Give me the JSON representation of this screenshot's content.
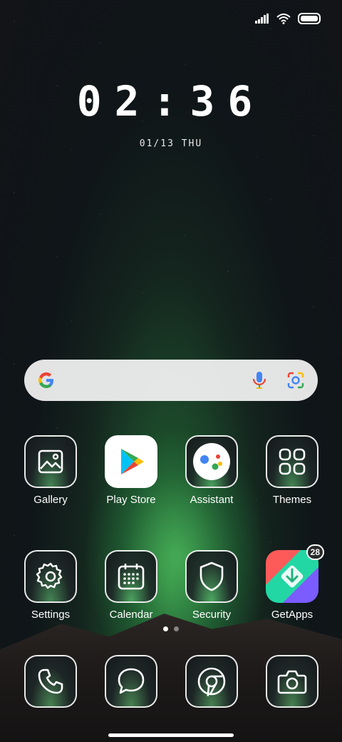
{
  "status": {
    "signal_icon": "cellular-signal-icon",
    "wifi_icon": "wifi-icon",
    "battery_icon": "battery-icon"
  },
  "clock": {
    "time": "02:36",
    "date": "01/13 THU"
  },
  "search": {
    "google_icon": "google-g-icon",
    "mic_icon": "microphone-icon",
    "lens_icon": "google-lens-icon"
  },
  "apps": [
    {
      "label": "Gallery",
      "icon": "gallery-icon"
    },
    {
      "label": "Play Store",
      "icon": "play-store-icon"
    },
    {
      "label": "Assistant",
      "icon": "assistant-icon"
    },
    {
      "label": "Themes",
      "icon": "themes-icon"
    },
    {
      "label": "Settings",
      "icon": "settings-gear-icon"
    },
    {
      "label": "Calendar",
      "icon": "calendar-icon"
    },
    {
      "label": "Security",
      "icon": "shield-icon"
    },
    {
      "label": "GetApps",
      "icon": "getapps-icon",
      "badge": "28"
    }
  ],
  "dock": [
    {
      "name": "phone",
      "icon": "phone-icon"
    },
    {
      "name": "messages",
      "icon": "message-bubble-icon"
    },
    {
      "name": "chrome",
      "icon": "chrome-icon"
    },
    {
      "name": "camera",
      "icon": "camera-icon"
    }
  ],
  "pages": {
    "count": 2,
    "active": 1
  },
  "colors": {
    "google_blue": "#4285F4",
    "google_red": "#EA4335",
    "google_yellow": "#FBBC05",
    "google_green": "#34A853"
  }
}
